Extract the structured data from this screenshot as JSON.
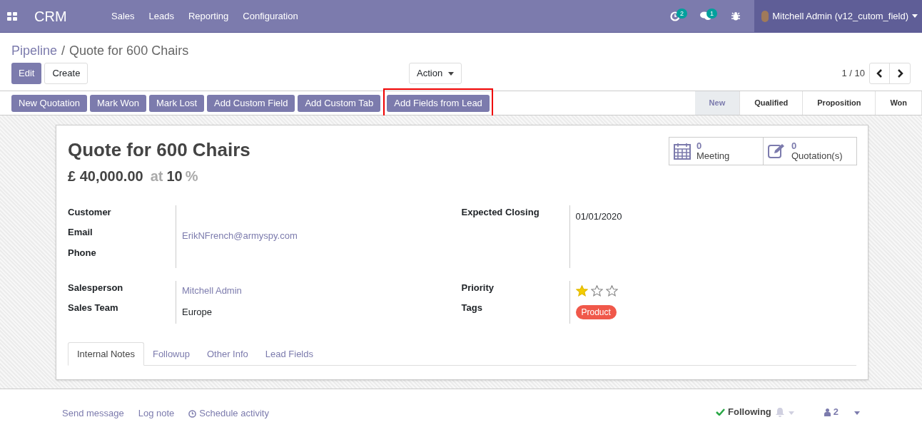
{
  "navbar": {
    "app_name": "CRM",
    "menus": [
      "Sales",
      "Leads",
      "Reporting",
      "Configuration"
    ],
    "systray": [
      {
        "kind": "activity",
        "count": "2"
      },
      {
        "kind": "chat",
        "count": "1"
      },
      {
        "kind": "debug"
      }
    ],
    "user": "Mitchell Admin (v12_cutom_field)"
  },
  "breadcrumb": {
    "parent": "Pipeline",
    "separator": "/",
    "current": "Quote for 600 Chairs"
  },
  "buttons": [
    {
      "label": "Edit",
      "kind": "primary"
    },
    {
      "label": "Create",
      "kind": "secondary"
    }
  ],
  "action": "Action",
  "pager": "1 / 10",
  "header_buttons": [
    {
      "label": "New Quotation",
      "highlighted": false
    },
    {
      "label": "Mark Won",
      "highlighted": false
    },
    {
      "label": "Mark Lost",
      "highlighted": false
    },
    {
      "label": "Add Custom Field",
      "highlighted": false
    },
    {
      "label": "Add Custom Tab",
      "highlighted": false
    },
    {
      "label": "Add Fields from Lead",
      "highlighted": true
    }
  ],
  "stages": [
    {
      "label": "New",
      "selected": true
    },
    {
      "label": "Qualified",
      "selected": false
    },
    {
      "label": "Proposition",
      "selected": false
    },
    {
      "label": "Won",
      "selected": false
    }
  ],
  "stat_buttons": [
    {
      "kind": "calendar",
      "value": "0",
      "label": "Meeting"
    },
    {
      "kind": "edit",
      "value": "0",
      "label": "Quotation(s)"
    }
  ],
  "record": {
    "title": "Quote for 600 Chairs",
    "revenue": "£ 40,000.00",
    "at": "at",
    "probability": "10",
    "percent": "%"
  },
  "field_groups": [
    {
      "left": [
        {
          "label": "Customer",
          "kind": "text"
        },
        {
          "label": "Email",
          "kind": "link",
          "value": "ErikNFrench@armyspy.com"
        },
        {
          "label": "Phone",
          "kind": "text"
        }
      ],
      "right": [
        {
          "label": "Expected Closing",
          "kind": "text",
          "value": "01/01/2020"
        }
      ]
    },
    {
      "left": [
        {
          "label": "Salesperson",
          "kind": "link",
          "value": "Mitchell Admin"
        },
        {
          "label": "Sales Team",
          "kind": "text",
          "value": "Europe"
        }
      ],
      "right": [
        {
          "label": "Priority",
          "kind": "stars",
          "stars": 1
        },
        {
          "label": "Tags",
          "kind": "tags",
          "tags": [
            {
              "label": "Product",
              "color": "#f0584a"
            }
          ]
        }
      ]
    }
  ],
  "tabs": [
    {
      "label": "Internal Notes",
      "selected": true
    },
    {
      "label": "Followup",
      "selected": false
    },
    {
      "label": "Other Info",
      "selected": false
    },
    {
      "label": "Lead Fields",
      "selected": false
    }
  ],
  "chatter": {
    "actions": [
      {
        "kind": "message",
        "label": "Send message"
      },
      {
        "kind": "note",
        "label": "Log note"
      },
      {
        "kind": "activity",
        "label": "Schedule activity"
      }
    ],
    "following": "Following",
    "followers": "2"
  }
}
